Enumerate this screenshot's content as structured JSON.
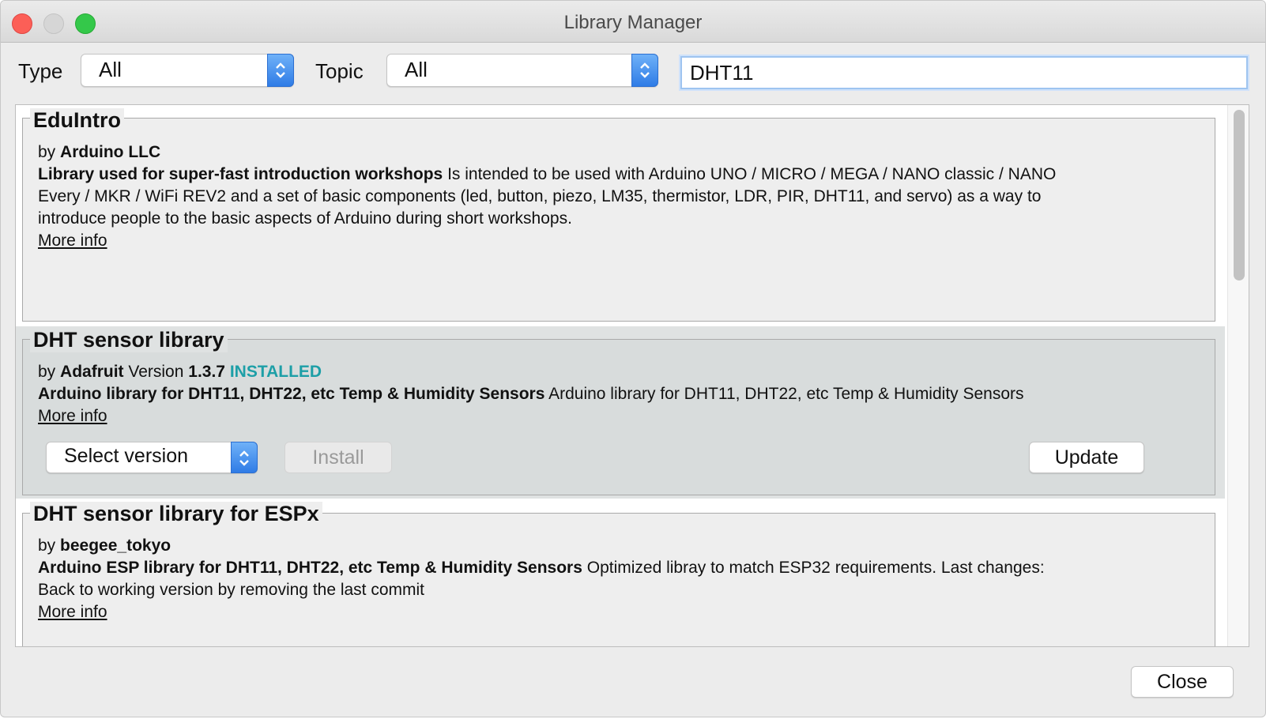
{
  "window": {
    "title": "Library Manager"
  },
  "filters": {
    "type_label": "Type",
    "type_value": "All",
    "topic_label": "Topic",
    "topic_value": "All",
    "search_value": "DHT11"
  },
  "libraries": [
    {
      "name": "EduIntro",
      "by_label": "by",
      "author": "Arduino LLC",
      "summary": "Library used for super-fast introduction workshops",
      "description_line1": "Is intended to be used with Arduino UNO / MICRO / MEGA / NANO classic / NANO",
      "description_line2": "Every / MKR / WiFi REV2 and a set of basic components (led, button, piezo, LM35, thermistor, LDR, PIR, DHT11, and servo) as a way to",
      "description_line3": "introduce people to the basic aspects of Arduino during short workshops.",
      "more_info": "More info"
    },
    {
      "name": "DHT sensor library",
      "by_label": "by",
      "author": "Adafruit",
      "version_label": "Version",
      "version": "1.3.7",
      "status": "INSTALLED",
      "summary": "Arduino library for DHT11, DHT22, etc Temp & Humidity Sensors",
      "description": "Arduino library for DHT11, DHT22, etc Temp & Humidity Sensors",
      "more_info": "More info",
      "select_version": "Select version",
      "install": "Install",
      "update": "Update"
    },
    {
      "name": "DHT sensor library for ESPx",
      "by_label": "by",
      "author": "beegee_tokyo",
      "summary": "Arduino ESP library for DHT11, DHT22, etc Temp & Humidity Sensors",
      "description_line1": "Optimized libray to match ESP32 requirements. Last changes:",
      "description_line2": "Back to working version by removing the last commit",
      "more_info": "More info"
    }
  ],
  "footer": {
    "close": "Close"
  },
  "colors": {
    "installed": "#1d9fa7",
    "link": "#1f37c7",
    "combo_accent": "#2f7ce6"
  }
}
